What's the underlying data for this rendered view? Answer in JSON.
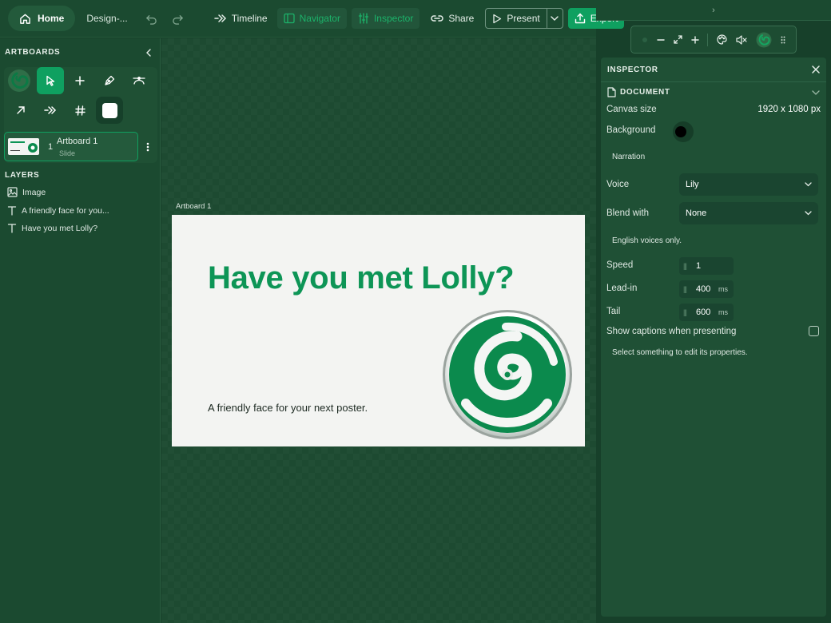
{
  "toolbar": {
    "home_label": "Home",
    "doc_name": "Design-...",
    "timeline_label": "Timeline",
    "navigator_label": "Navigator",
    "inspector_label": "Inspector",
    "share_label": "Share",
    "present_label": "Present",
    "export_label": "Export"
  },
  "sidebar": {
    "artboards_title": "ARTBOARDS",
    "artboards": [
      {
        "number": "1",
        "name": "Artboard 1",
        "type": "Slide"
      }
    ],
    "layers_title": "LAYERS",
    "layers": [
      {
        "icon": "image-icon",
        "label": "Image"
      },
      {
        "icon": "text-icon",
        "label": "A friendly face for you..."
      },
      {
        "icon": "text-icon",
        "label": "Have you met Lolly?"
      }
    ]
  },
  "canvas": {
    "artboard_label": "Artboard 1",
    "heading": "Have you met Lolly?",
    "subtext": "A friendly face for your next poster.",
    "heading_color": "#0d9556",
    "background_color": "#f3f4f2"
  },
  "right_top": {
    "chevron": "›"
  },
  "inspector": {
    "title": "INSPECTOR",
    "document_title": "DOCUMENT",
    "canvas_size_label": "Canvas size",
    "canvas_size_value": "1920 x 1080 px",
    "background_label": "Background",
    "background_color": "#000000",
    "narration_label": "Narration",
    "voice_label": "Voice",
    "voice_value": "Lily",
    "blend_label": "Blend with",
    "blend_value": "None",
    "english_note": "English voices only.",
    "speed_label": "Speed",
    "speed_value": "1",
    "leadin_label": "Lead-in",
    "leadin_value": "400",
    "leadin_unit": "ms",
    "tail_label": "Tail",
    "tail_value": "600",
    "tail_unit": "ms",
    "captions_label": "Show captions when presenting",
    "captions_checked": false,
    "select_hint": "Select something to edit its properties."
  },
  "colors": {
    "accent": "#0fa060",
    "panel": "#1b4a30",
    "canvas": "#1d4a31"
  }
}
